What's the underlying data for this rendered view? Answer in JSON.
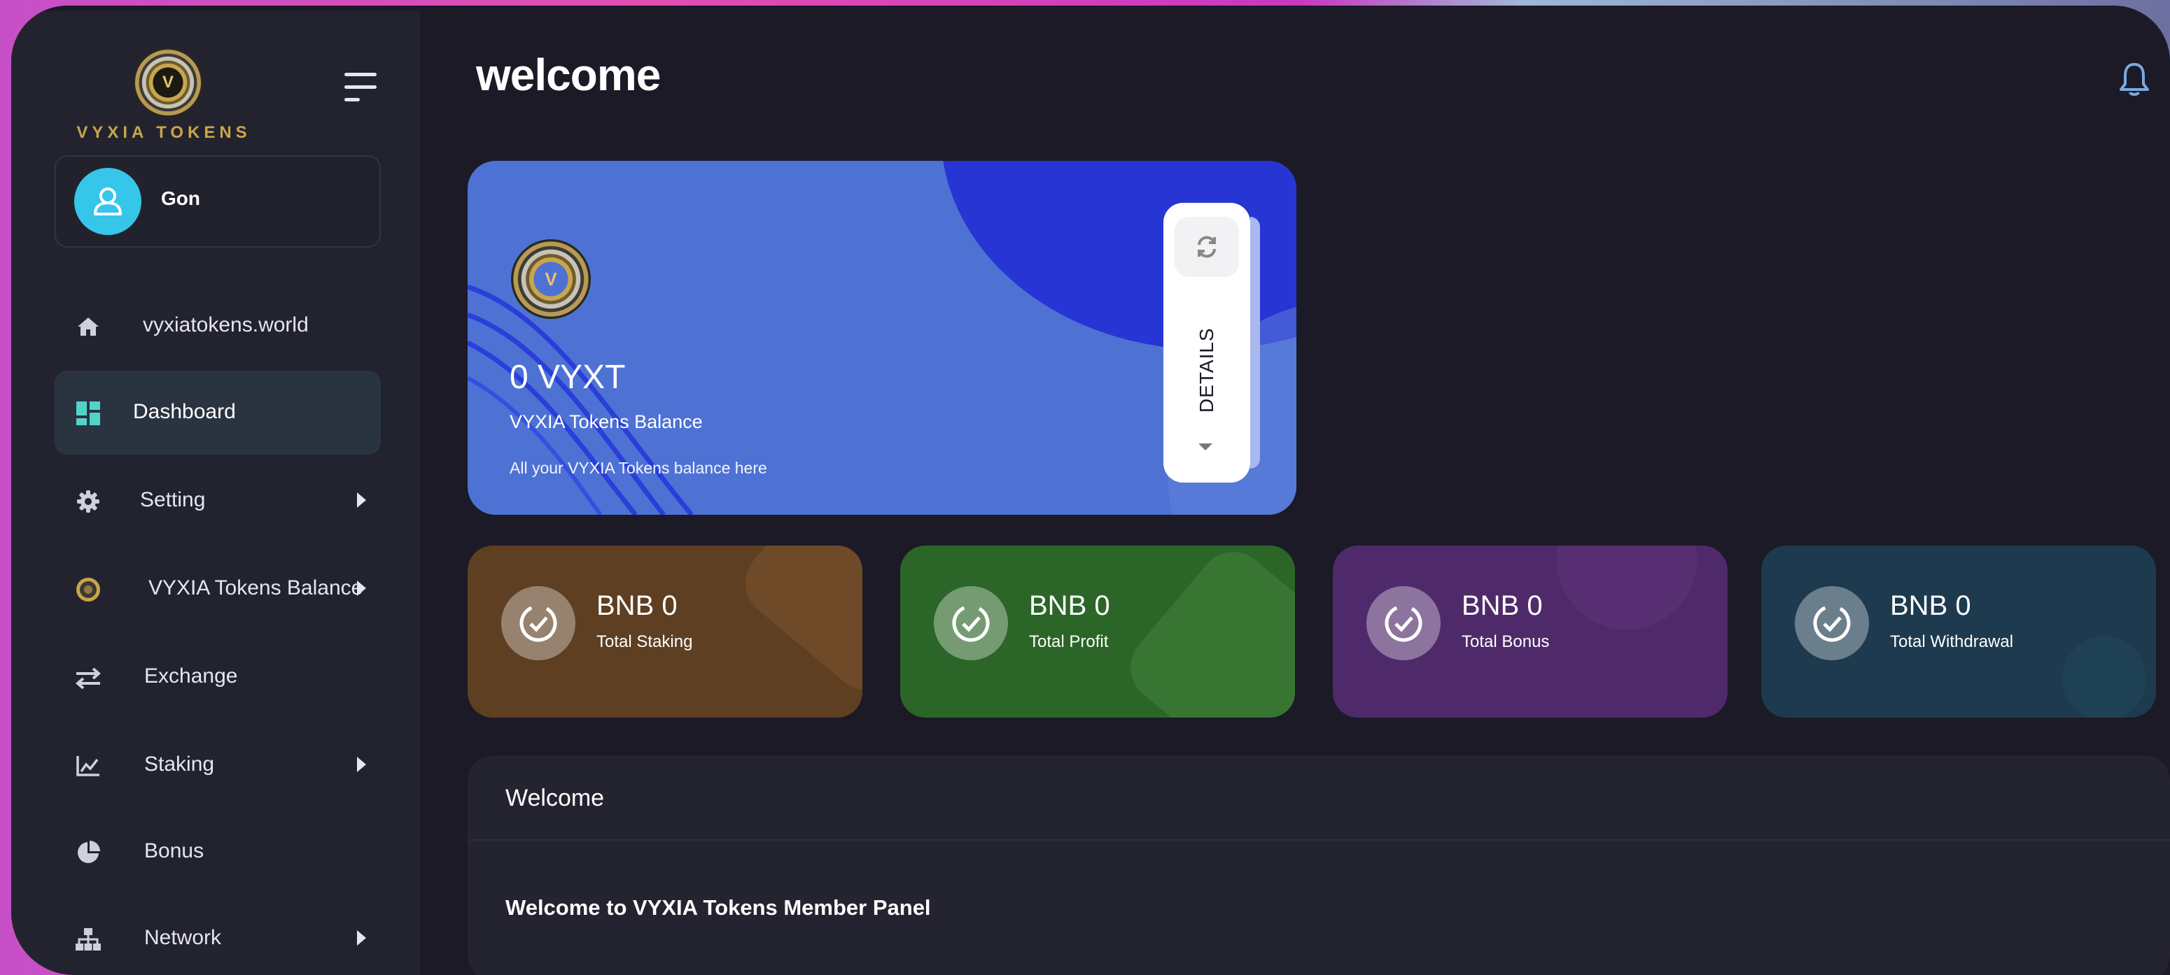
{
  "brand": {
    "logo_letter": "V",
    "name": "VYXIA TOKENS"
  },
  "user": {
    "name": "Gon"
  },
  "nav": {
    "items": [
      {
        "label": "vyxiatokens.world",
        "icon": "home-icon",
        "has_submenu": false,
        "active": false
      },
      {
        "label": "Dashboard",
        "icon": "dashboard-icon",
        "has_submenu": false,
        "active": true
      },
      {
        "label": "Setting",
        "icon": "gear-icon",
        "has_submenu": true,
        "active": false
      },
      {
        "label": "VYXIA Tokens Balance",
        "icon": "coin-icon",
        "has_submenu": true,
        "active": false
      },
      {
        "label": "Exchange",
        "icon": "exchange-icon",
        "has_submenu": false,
        "active": false
      },
      {
        "label": "Staking",
        "icon": "chart-line-icon",
        "has_submenu": true,
        "active": false
      },
      {
        "label": "Bonus",
        "icon": "pie-chart-icon",
        "has_submenu": false,
        "active": false
      },
      {
        "label": "Network",
        "icon": "network-icon",
        "has_submenu": true,
        "active": false
      }
    ]
  },
  "header": {
    "title": "welcome"
  },
  "balance_card": {
    "amount": "0 VYXT",
    "subtitle": "VYXIA Tokens Balance",
    "note": "All your VYXIA Tokens balance here",
    "details_label": "DETAILS"
  },
  "stats": [
    {
      "value": "BNB 0",
      "label": "Total Staking",
      "color": "#5e3f22"
    },
    {
      "value": "BNB 0",
      "label": "Total Profit",
      "color": "#2b6628"
    },
    {
      "value": "BNB 0",
      "label": "Total Bonus",
      "color": "#4f2a6a"
    },
    {
      "value": "BNB 0",
      "label": "Total Withdrawal",
      "color": "#1d3a4e"
    }
  ],
  "welcome_panel": {
    "heading": "Welcome",
    "message": "Welcome to VYXIA Tokens Member Panel"
  },
  "colors": {
    "background": "#1b1a26",
    "sidebar": "#232330",
    "active_nav": "#2a3441",
    "balance_card": "#4e72d4",
    "avatar": "#36c6ea"
  }
}
